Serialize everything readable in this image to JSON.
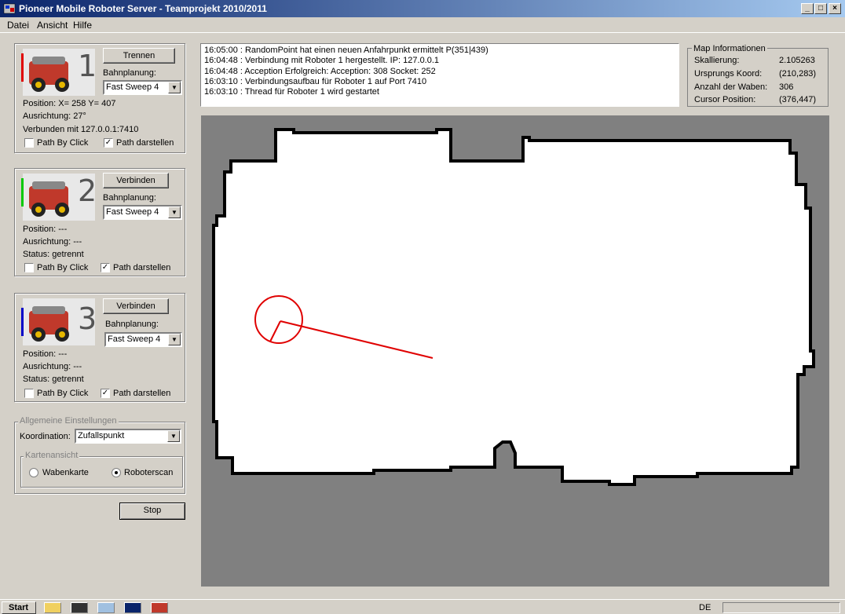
{
  "window": {
    "title": "Pioneer Mobile Roboter Server - Teamprojekt 2010/2011"
  },
  "menu": {
    "file": "Datei",
    "view": "Ansicht",
    "help": "Hilfe"
  },
  "robots": [
    {
      "number": "1",
      "color": "#e00000",
      "button": "Trennen",
      "planning_label": "Bahnplanung:",
      "planning": "Fast Sweep 4",
      "position": "Position: X= 258 Y= 407",
      "orientation": "Ausrichtung: 27°",
      "status": "Verbunden mit 127.0.0.1:7410",
      "path_by_click": "Path By Click",
      "path_by_click_checked": false,
      "show_path": "Path darstellen",
      "show_path_checked": true
    },
    {
      "number": "2",
      "color": "#00c800",
      "button": "Verbinden",
      "planning_label": "Bahnplanung:",
      "planning": "Fast Sweep 4",
      "position": "Position: ---",
      "orientation": "Ausrichtung: ---",
      "status": "Status: getrennt",
      "path_by_click": "Path By Click",
      "path_by_click_checked": false,
      "show_path": "Path darstellen",
      "show_path_checked": true
    },
    {
      "number": "3",
      "color": "#0000c8",
      "button": "Verbinden",
      "planning_label": "Bahnplanung:",
      "planning": "Fast Sweep 4",
      "position": "Position: ---",
      "orientation": "Ausrichtung: ---",
      "status": "Status: getrennt",
      "path_by_click": "Path By Click",
      "path_by_click_checked": false,
      "show_path": "Path darstellen",
      "show_path_checked": true
    }
  ],
  "settings": {
    "title": "Allgemeine Einstellungen",
    "coordination_label": "Koordination:",
    "coordination": "Zufallspunkt",
    "mapview_title": "Kartenansicht",
    "option_honeycomb": "Wabenkarte",
    "option_scan": "Roboterscan",
    "selected": "Roboterscan",
    "stop": "Stop"
  },
  "log": [
    "16:05:00 : RandomPoint hat einen neuen Anfahrpunkt ermittelt P(351|439)",
    "16:04:48 : Verbindung mit Roboter 1 hergestellt. IP: 127.0.0.1",
    "16:04:48 : Acception Erfolgreich: Acception: 308 Socket: 252",
    "16:03:10 : Verbindungsaufbau für Roboter 1 auf Port 7410",
    "16:03:10 : Thread für Roboter 1 wird gestartet"
  ],
  "map_info": {
    "title": "Map Informationen",
    "rows": [
      {
        "label": "Skallierung:",
        "value": "2.105263"
      },
      {
        "label": "Ursprungs Koord:",
        "value": "(210,283)"
      },
      {
        "label": "Anzahl der Waben:",
        "value": "306"
      },
      {
        "label": "Cursor Position:",
        "value": "(376,447)"
      }
    ]
  },
  "colors": {
    "map_background": "#808080",
    "free_space": "#ffffff",
    "walls": "#000000",
    "robot_marker": "#e00000"
  },
  "taskbar": {
    "start": "Start",
    "language": "DE"
  }
}
